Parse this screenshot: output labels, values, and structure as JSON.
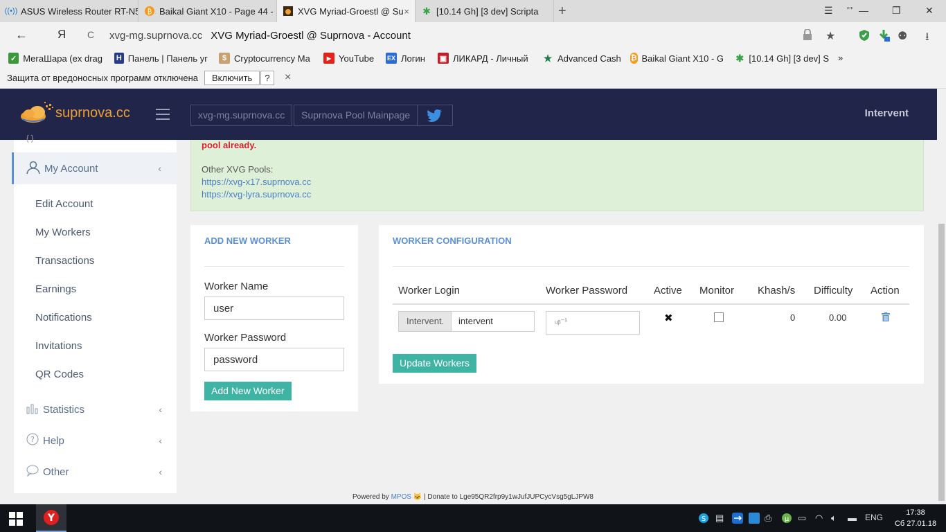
{
  "browser": {
    "tabs": [
      {
        "label": "ASUS Wireless Router RT-N5",
        "icon": "wifi-icon"
      },
      {
        "label": "Baikal Giant X10 - Page 44 -",
        "icon": "bitcoin-icon"
      },
      {
        "label": "XVG Myriad-Groestl @ Su",
        "icon": "suprnova-icon",
        "active": true
      },
      {
        "label": "[10.14 Gh] [3 dev] Scripta",
        "icon": "gear-icon"
      }
    ],
    "tab_close": "×",
    "new_tab": "+",
    "url_domain": "xvg-mg.suprnova.cc",
    "page_title": "XVG Myriad-Groestl @ Suprnova - Account",
    "bookmarks": [
      {
        "label": "МегаШара (ex drag",
        "color": "#3a9a3a"
      },
      {
        "label": "Панель | Панель уг",
        "color": "#2a3a8a"
      },
      {
        "label": "Cryptocurrency Ma",
        "color": "#c9a070"
      },
      {
        "label": "YouTube",
        "color": "#e62117"
      },
      {
        "label": "Логин",
        "color": "#2a6bd8"
      },
      {
        "label": "ЛИКАРД - Личный",
        "color": "#c0202a"
      },
      {
        "label": "Advanced Cash",
        "color": "#1e7a4a"
      },
      {
        "label": "Baikal Giant X10 - G",
        "color": "#f59a1a"
      },
      {
        "label": "[10.14 Gh] [3 dev] S",
        "color": "#3aa04a"
      }
    ],
    "bookmarks_more": "»",
    "warning": {
      "text": "Защита от вредоносных программ отключена",
      "button": "Включить",
      "help": "?",
      "close": "×"
    }
  },
  "header": {
    "logo_text": "suprnova.cc",
    "buttons": [
      "xvg-mg.suprnova.cc",
      "Suprnova Pool Mainpage"
    ],
    "user": "Intervent"
  },
  "sidebar": {
    "account_label": "My Account",
    "account_items": [
      "Edit Account",
      "My Workers",
      "Transactions",
      "Earnings",
      "Notifications",
      "Invitations",
      "QR Codes"
    ],
    "groups": [
      "Statistics",
      "Help",
      "Other"
    ]
  },
  "alert": {
    "red_text": "pool already.",
    "other_label": "Other XVG Pools:",
    "links": [
      "https://xvg-x17.suprnova.cc",
      "https://xvg-lyra.suprnova.cc"
    ]
  },
  "add_worker": {
    "title": "ADD NEW WORKER",
    "name_label": "Worker Name",
    "name_value": "user",
    "password_label": "Worker Password",
    "password_value": "password",
    "button": "Add New Worker"
  },
  "worker_config": {
    "title": "WORKER CONFIGURATION",
    "columns": [
      "Worker Login",
      "Worker Password",
      "Active",
      "Monitor",
      "Khash/s",
      "Difficulty",
      "Action"
    ],
    "row": {
      "login_prefix": "Intervent.",
      "login": "intervent",
      "password": "ᵤᵦ⁻¹",
      "active": "✖",
      "monitor": false,
      "khash": "0",
      "difficulty": "0.00"
    },
    "button": "Update Workers"
  },
  "footer": {
    "powered": "Powered by",
    "mpos": "MPOS",
    "donate": "| Donate to Lge95QR2frp9y1wJufJUPCycVsg5gLJPW8"
  },
  "taskbar": {
    "lang": "ENG",
    "time": "17:38",
    "date": "Сб 27.01.18"
  },
  "colors": {
    "header_bg": "#22254a",
    "accent_blue": "#5b8fd6",
    "button_teal": "#3fb3a4",
    "alert_green": "#dff0d8",
    "alert_red": "#d9202f"
  }
}
